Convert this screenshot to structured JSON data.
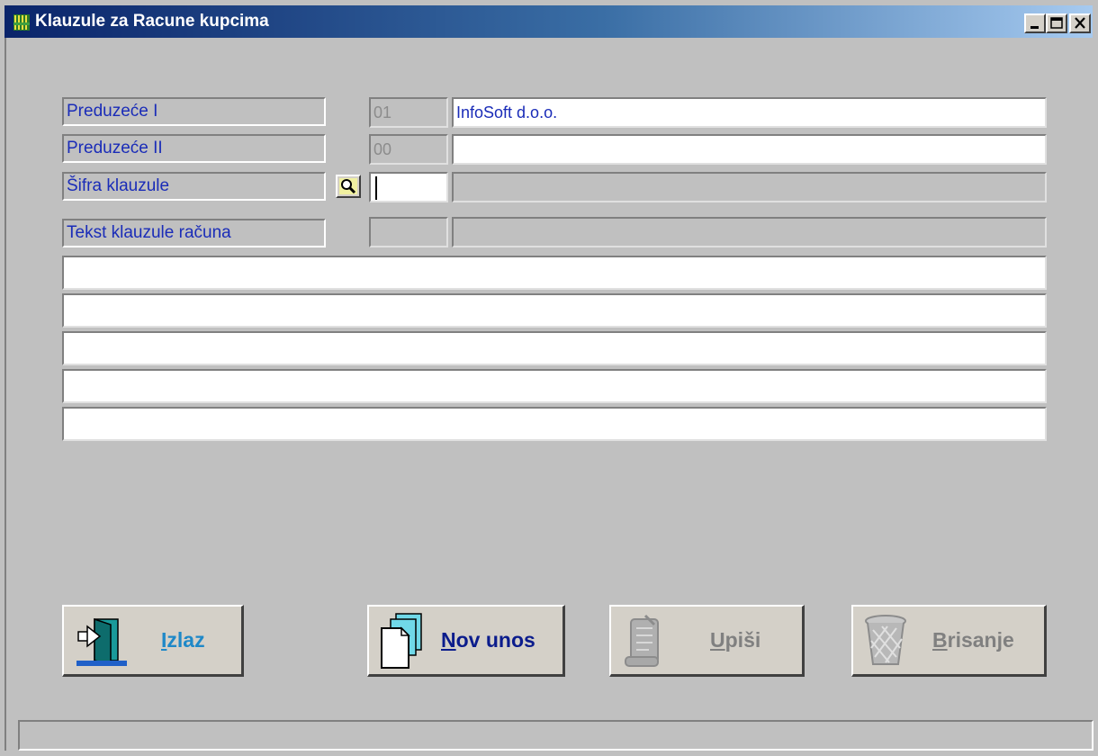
{
  "window": {
    "title": "Klauzule za Racune kupcima"
  },
  "form": {
    "preduzece1": {
      "label": "Preduzeće I",
      "code": "01",
      "name": "InfoSoft d.o.o."
    },
    "preduzece2": {
      "label": "Preduzeće II",
      "code": "00",
      "name": ""
    },
    "sifra": {
      "label": "Šifra klauzule",
      "code": "",
      "name": ""
    },
    "tekst": {
      "label": "Tekst klauzule računa",
      "code": "",
      "name": ""
    },
    "text_lines": [
      "",
      "",
      "",
      "",
      ""
    ]
  },
  "buttons": {
    "izlaz": {
      "hotkey": "I",
      "rest": "zlaz"
    },
    "nov_unos": {
      "hotkey": "N",
      "rest": "ov unos"
    },
    "upisi": {
      "hotkey": "U",
      "rest": "piši"
    },
    "brisanje": {
      "hotkey": "B",
      "rest": "risanje"
    }
  },
  "colors": {
    "label_text": "#1a2cb8",
    "disabled_text": "#808080",
    "enabled_button_text": "#0b1c8c",
    "izlaz_text": "#1e88c8"
  },
  "icons": {
    "search": "magnifier-icon",
    "izlaz": "exit-door-icon",
    "nov_unos": "new-document-icon",
    "upisi": "save-scroll-icon",
    "brisanje": "trash-basket-icon"
  }
}
